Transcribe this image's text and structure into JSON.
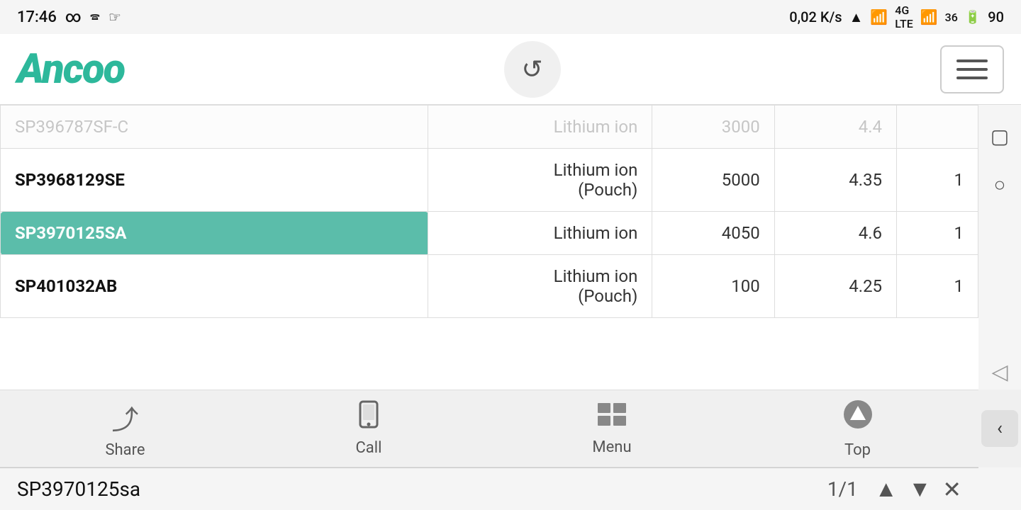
{
  "statusBar": {
    "time": "17:46",
    "dataSpeed": "0,02 K/s",
    "battery": "90",
    "icons": {
      "infinity": "∞",
      "phone1": "🕿",
      "hand": "☞",
      "wifi": "WiFi",
      "signal4g": "4G",
      "signal3g": "3G"
    }
  },
  "header": {
    "logoText": "Ancoo",
    "loadingChar": "↺",
    "menuLabel": "≡"
  },
  "tableRows": [
    {
      "id": "SP396787SF-C",
      "chemistry": "Lithium ion",
      "capacity": "3000",
      "voltage": "4.4",
      "qty": "",
      "ghost": true,
      "highlighted": false
    },
    {
      "id": "SP3968129SE",
      "chemistry": "Lithium ion\n(Pouch)",
      "capacity": "5000",
      "voltage": "4.35",
      "qty": "1",
      "ghost": false,
      "highlighted": false
    },
    {
      "id": "SP3970125SA",
      "chemistry": "Lithium ion",
      "capacity": "4050",
      "voltage": "4.6",
      "qty": "1",
      "ghost": false,
      "highlighted": true
    },
    {
      "id": "SP401032AB",
      "chemistry": "Lithium ion\n(Pouch)",
      "capacity": "100",
      "voltage": "4.25",
      "qty": "1",
      "ghost": false,
      "highlighted": false
    }
  ],
  "toolbar": {
    "items": [
      {
        "icon": "share",
        "label": "Share",
        "unicode": "⤴"
      },
      {
        "icon": "call",
        "label": "Call",
        "unicode": "📱"
      },
      {
        "icon": "menu",
        "label": "Menu",
        "unicode": "⊟"
      },
      {
        "icon": "top",
        "label": "Top",
        "unicode": "⬆"
      }
    ]
  },
  "searchBar": {
    "term": "SP3970125sa",
    "count": "1/1",
    "upLabel": "▲",
    "downLabel": "▼",
    "closeLabel": "✕"
  },
  "rightButtons": {
    "squareIcon": "▢",
    "circleIcon": "○"
  },
  "backButton": {
    "label": "‹",
    "outlineLabel": "◁"
  }
}
